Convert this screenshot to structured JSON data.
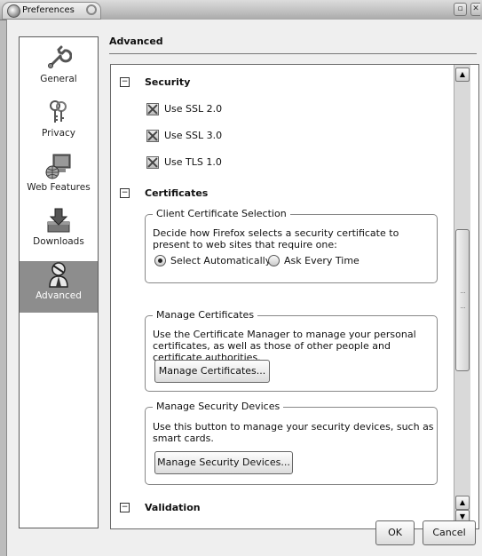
{
  "window": {
    "title": "Preferences"
  },
  "sidebar": {
    "items": [
      {
        "label": "General",
        "icon": "wrench-icon",
        "selected": false
      },
      {
        "label": "Privacy",
        "icon": "keys-icon",
        "selected": false
      },
      {
        "label": "Web Features",
        "icon": "computer-globe-icon",
        "selected": false
      },
      {
        "label": "Downloads",
        "icon": "downloads-tray-icon",
        "selected": false
      },
      {
        "label": "Advanced",
        "icon": "advanced-person-icon",
        "selected": true
      }
    ]
  },
  "pane": {
    "title": "Advanced",
    "security": {
      "heading": "Security",
      "expander": "−",
      "options": [
        {
          "label": "Use SSL 2.0",
          "checked": true
        },
        {
          "label": "Use SSL 3.0",
          "checked": true
        },
        {
          "label": "Use TLS 1.0",
          "checked": true
        }
      ]
    },
    "certificates": {
      "heading": "Certificates",
      "expander": "−",
      "client_selection": {
        "legend": "Client Certificate Selection",
        "description": "Decide how Firefox selects a security certificate to present to web sites that require one:",
        "option_auto": "Select Automatically",
        "option_ask": "Ask Every Time",
        "selected": "Select Automatically"
      },
      "manage_certs": {
        "legend": "Manage Certificates",
        "description": "Use the Certificate Manager to manage your personal certificates, as well as those of other people and certificate authorities.",
        "button": "Manage Certificates..."
      },
      "security_devices": {
        "legend": "Manage Security Devices",
        "description": "Use this button to manage your security devices, such as smart cards.",
        "button": "Manage Security Devices..."
      }
    },
    "validation": {
      "heading": "Validation",
      "expander": "−"
    }
  },
  "buttons": {
    "ok": "OK",
    "cancel": "Cancel"
  }
}
